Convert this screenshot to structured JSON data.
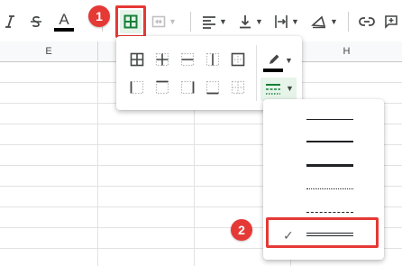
{
  "toolbar": {
    "italic_icon": "italic-icon",
    "strikethrough_icon": "strikethrough-icon",
    "text_color_label": "A",
    "text_color_swatch": "#000000",
    "borders_icon": "borders-icon",
    "merge_icon": "merge-cells-icon",
    "align_icon": "horizontal-align-icon",
    "valign_icon": "vertical-align-icon",
    "wrap_icon": "text-wrapping-icon",
    "rotate_icon": "text-rotation-icon",
    "link_icon": "insert-link-icon",
    "comment_icon": "insert-comment-icon"
  },
  "columns": [
    "E",
    "",
    "",
    "H"
  ],
  "borders_menu": {
    "row1": [
      "all-borders-icon",
      "inner-borders-icon",
      "horizontal-borders-icon",
      "vertical-borders-icon",
      "outer-borders-icon"
    ],
    "row2": [
      "left-border-icon",
      "top-border-icon",
      "right-border-icon",
      "bottom-border-icon",
      "clear-borders-icon"
    ],
    "border_color_swatch": "#000000",
    "border_style_icon": "border-style-icon"
  },
  "border_styles": [
    {
      "name": "thin-solid"
    },
    {
      "name": "medium-solid"
    },
    {
      "name": "thick-solid"
    },
    {
      "name": "dotted"
    },
    {
      "name": "dashed"
    },
    {
      "name": "double",
      "selected": true
    }
  ],
  "selected_check": "✓",
  "annotations": {
    "badge_1": "1",
    "badge_2": "2"
  },
  "colors": {
    "accent_green": "#188038",
    "annotation_red": "#e53935"
  }
}
